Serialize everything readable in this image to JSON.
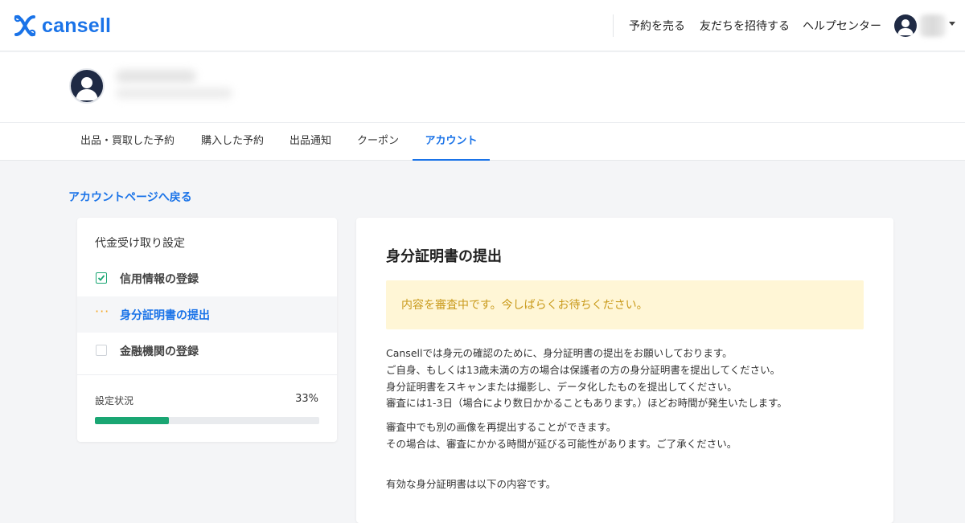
{
  "brand": {
    "name": "cansell",
    "color": "#1a73e8"
  },
  "header": {
    "nav": [
      {
        "label": "予約を売る"
      },
      {
        "label": "友だちを招待する"
      },
      {
        "label": "ヘルプセンター"
      }
    ]
  },
  "tabs": [
    {
      "label": "出品・買取した予約",
      "active": false
    },
    {
      "label": "購入した予約",
      "active": false
    },
    {
      "label": "出品通知",
      "active": false
    },
    {
      "label": "クーポン",
      "active": false
    },
    {
      "label": "アカウント",
      "active": true
    }
  ],
  "back_link": "アカウントページへ戻る",
  "sidebar": {
    "title": "代金受け取り設定",
    "steps": [
      {
        "label": "信用情報の登録",
        "state": "done",
        "icon": "check-icon"
      },
      {
        "label": "身分証明書の提出",
        "state": "in-progress",
        "icon": "dots-icon"
      },
      {
        "label": "金融機関の登録",
        "state": "todo",
        "icon": "empty-checkbox-icon"
      }
    ],
    "status_label": "設定状況",
    "status_percent": "33%",
    "progress": 0.33
  },
  "main": {
    "title": "身分証明書の提出",
    "notice": "内容を審査中です。今しばらくお待ちください。",
    "paragraph1": [
      "Cansellでは身元の確認のために、身分証明書の提出をお願いしております。",
      "ご自身、もしくは13歳未満の方の場合は保護者の方の身分証明書を提出してください。",
      "身分証明書をスキャンまたは撮影し、データ化したものを提出してください。",
      "審査には1-3日（場合により数日かかることもあります。）ほどお時間が発生いたします。"
    ],
    "paragraph2": [
      "審査中でも別の画像を再提出することができます。",
      "その場合は、審査にかかる時間が延びる可能性があります。ご了承ください。"
    ],
    "paragraph3": "有効な身分証明書は以下の内容です。"
  },
  "colors": {
    "accent": "#1a73e8",
    "success": "#1aa673",
    "warning_bg": "#fff6d6",
    "warning_text": "#c99a1b",
    "in_progress": "#f5a623"
  }
}
